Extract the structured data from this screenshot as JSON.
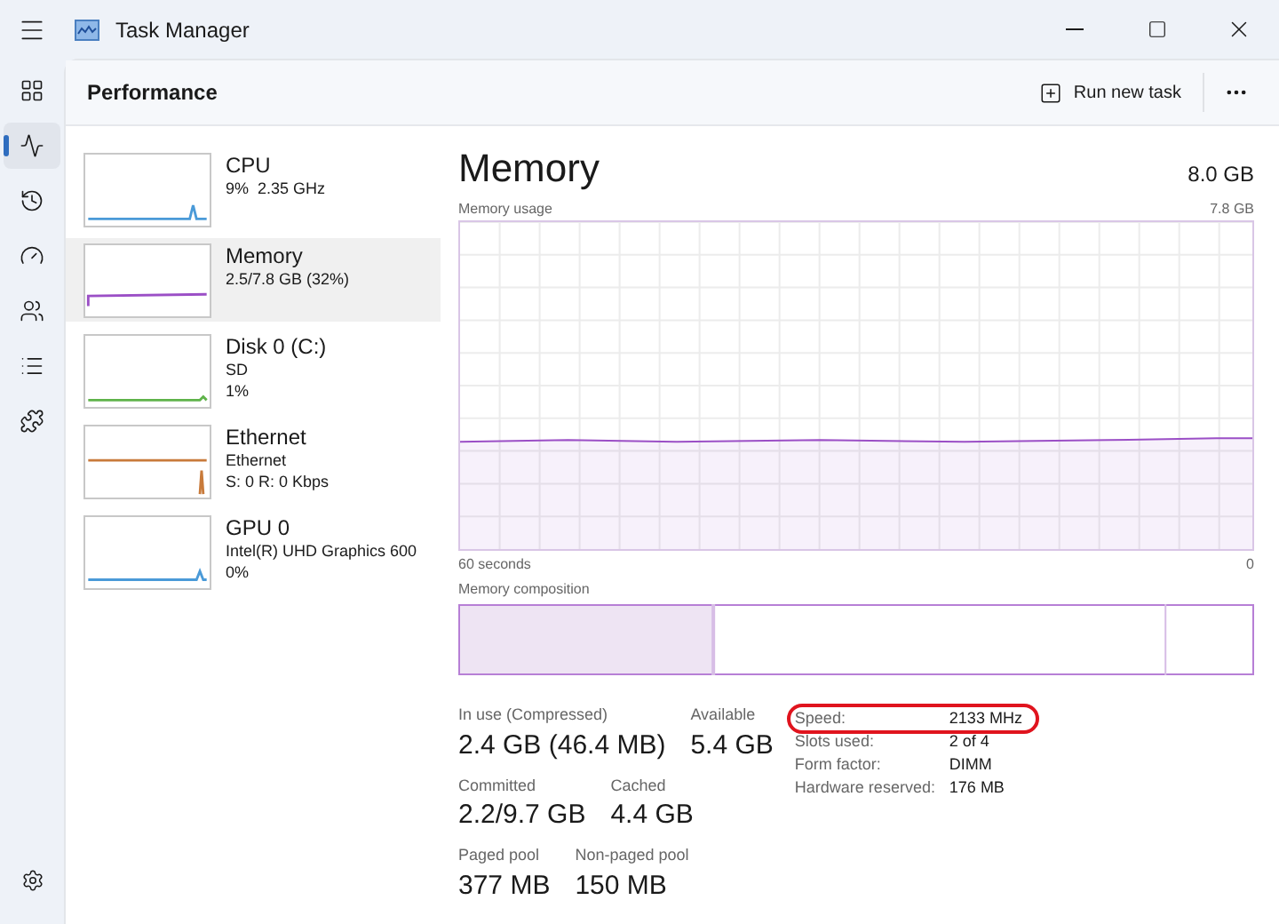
{
  "window": {
    "title": "Task Manager"
  },
  "nav": [
    {
      "kind": "processes",
      "selected": false
    },
    {
      "kind": "performance",
      "selected": true
    },
    {
      "kind": "history",
      "selected": false
    },
    {
      "kind": "startup",
      "selected": false
    },
    {
      "kind": "users",
      "selected": false
    },
    {
      "kind": "details",
      "selected": false
    },
    {
      "kind": "services",
      "selected": false
    }
  ],
  "header": {
    "title": "Performance",
    "run_task": "Run new task"
  },
  "devices": [
    {
      "name": "CPU",
      "lines": [
        "9%  2.35 GHz"
      ],
      "selected": false,
      "color": "#4a9ad8"
    },
    {
      "name": "Memory",
      "lines": [
        "2.5/7.8 GB (32%)"
      ],
      "selected": true,
      "color": "#9b4fc6"
    },
    {
      "name": "Disk 0 (C:)",
      "lines": [
        "SD",
        "1%"
      ],
      "selected": false,
      "color": "#5fb34a"
    },
    {
      "name": "Ethernet",
      "lines": [
        "Ethernet",
        "S: 0 R: 0 Kbps"
      ],
      "selected": false,
      "color": "#c87a3a"
    },
    {
      "name": "GPU 0",
      "lines": [
        "Intel(R) UHD Graphics 600",
        "0%"
      ],
      "selected": false,
      "color": "#4a9ad8"
    }
  ],
  "detail": {
    "title": "Memory",
    "total": "8.0 GB",
    "usage_label": "Memory usage",
    "usage_max": "7.8 GB",
    "time_label": "60 seconds",
    "time_end": "0",
    "composition_label": "Memory composition",
    "stats": [
      [
        {
          "label": "In use (Compressed)",
          "value": "2.4 GB (46.4 MB)"
        },
        {
          "label": "Available",
          "value": "5.4 GB"
        }
      ],
      [
        {
          "label": "Committed",
          "value": "2.2/9.7 GB"
        },
        {
          "label": "Cached",
          "value": "4.4 GB"
        }
      ],
      [
        {
          "label": "Paged pool",
          "value": "377 MB"
        },
        {
          "label": "Non-paged pool",
          "value": "150 MB"
        }
      ]
    ],
    "specs": [
      {
        "label": "Speed:",
        "value": "2133 MHz",
        "highlighted": true
      },
      {
        "label": "Slots used:",
        "value": "2 of 4",
        "highlighted": false
      },
      {
        "label": "Form factor:",
        "value": "DIMM",
        "highlighted": false
      },
      {
        "label": "Hardware reserved:",
        "value": "176 MB",
        "highlighted": false
      }
    ]
  }
}
